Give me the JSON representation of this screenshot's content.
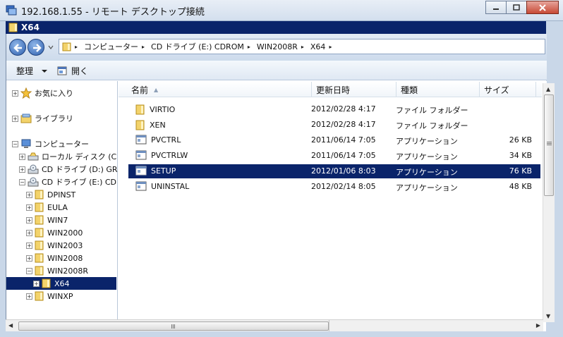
{
  "window": {
    "remote_title": "192.168.1.55 - リモート デスクトップ接続",
    "explorer_title": "X64"
  },
  "address": {
    "crumbs": [
      "コンピューター",
      "CD ドライブ (E:) CDROM",
      "WIN2008R",
      "X64"
    ]
  },
  "toolbar": {
    "organize_label": "整理",
    "open_label": "開く"
  },
  "nav": {
    "items": [
      {
        "label": "お気に入り",
        "icon": "star-icon"
      },
      {
        "label": "ライブラリ",
        "icon": "library-icon"
      },
      {
        "label": "コンピューター",
        "icon": "computer-icon"
      },
      {
        "label": "ローカル ディスク (C:)",
        "icon": "disk-icon"
      },
      {
        "label": "CD ドライブ (D:) GRM",
        "icon": "cd-icon"
      },
      {
        "label": "CD ドライブ (E:) CDRC",
        "icon": "cd-icon"
      },
      {
        "label": "DPINST",
        "icon": "folder-icon"
      },
      {
        "label": "EULA",
        "icon": "folder-icon"
      },
      {
        "label": "WIN7",
        "icon": "folder-icon"
      },
      {
        "label": "WIN2000",
        "icon": "folder-icon"
      },
      {
        "label": "WIN2003",
        "icon": "folder-icon"
      },
      {
        "label": "WIN2008",
        "icon": "folder-icon"
      },
      {
        "label": "WIN2008R",
        "icon": "folder-icon"
      },
      {
        "label": "X64",
        "icon": "folder-icon"
      },
      {
        "label": "WINXP",
        "icon": "folder-icon"
      }
    ]
  },
  "columns": {
    "name": "名前",
    "date": "更新日時",
    "type": "種類",
    "size": "サイズ"
  },
  "files": [
    {
      "name": "VIRTIO",
      "date": "2012/02/28 4:17",
      "type": "ファイル フォルダー",
      "size": "",
      "icon": "folder-icon"
    },
    {
      "name": "XEN",
      "date": "2012/02/28 4:17",
      "type": "ファイル フォルダー",
      "size": "",
      "icon": "folder-icon"
    },
    {
      "name": "PVCTRL",
      "date": "2011/06/14 7:05",
      "type": "アプリケーション",
      "size": "26 KB",
      "icon": "application-icon"
    },
    {
      "name": "PVCTRLW",
      "date": "2011/06/14 7:05",
      "type": "アプリケーション",
      "size": "34 KB",
      "icon": "application-icon"
    },
    {
      "name": "SETUP",
      "date": "2012/01/06 8:03",
      "type": "アプリケーション",
      "size": "76 KB",
      "icon": "application-icon"
    },
    {
      "name": "UNINSTAL",
      "date": "2012/02/14 8:05",
      "type": "アプリケーション",
      "size": "48 KB",
      "icon": "application-icon"
    }
  ],
  "scroll": {
    "grip": "III"
  }
}
